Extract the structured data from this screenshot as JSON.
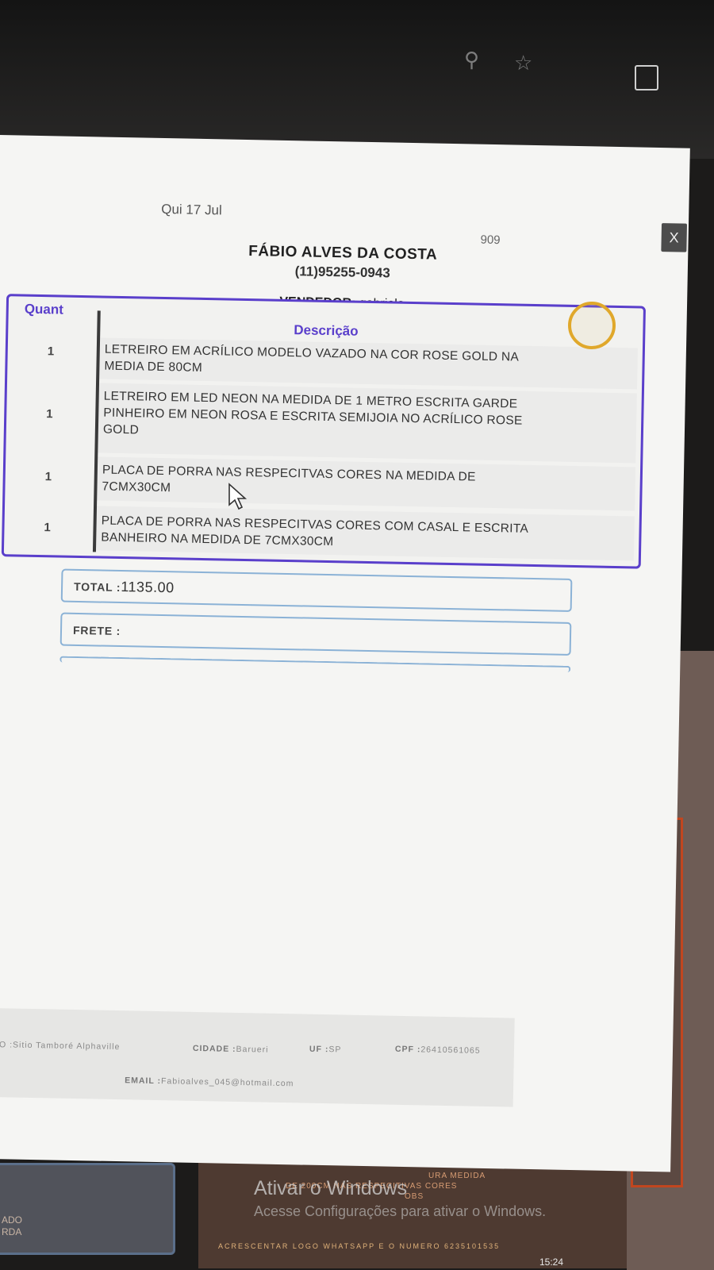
{
  "modal": {
    "close_label": "X",
    "date": "Qui 17 Jul",
    "order_number": "909",
    "customer_name": "FÁBIO ALVES DA COSTA",
    "customer_phone": "(11)95255-0943",
    "seller_label": "VENDEDOR:",
    "seller_name": "gabriela"
  },
  "items_table": {
    "headers": {
      "quant": "Quant",
      "description": "Descrição"
    },
    "rows": [
      {
        "qty": "1",
        "description": "LETREIRO EM ACRÍLICO MODELO VAZADO NA COR ROSE GOLD NA MEDIA DE 80CM"
      },
      {
        "qty": "1",
        "description": "LETREIRO EM LED NEON NA MEDIDA DE 1 METRO ESCRITA GARDE PINHEIRO EM NEON ROSA E ESCRITA SEMIJOIA NO ACRÍLICO ROSE GOLD"
      },
      {
        "qty": "1",
        "description": "PLACA DE PORRA NAS RESPECITVAS CORES NA MEDIDA DE 7CMX30CM"
      },
      {
        "qty": "1",
        "description": "PLACA DE PORRA NAS RESPECITVAS CORES COM CASAL E ESCRITA BANHEIRO NA MEDIDA DE 7CMX30CM"
      }
    ]
  },
  "totals": {
    "total_label": "TOTAL :",
    "total_value": "1135.00",
    "frete_label": "FRETE :",
    "frete_value": ""
  },
  "address": {
    "bairro": "IRRO :Sitio Tamboré Alphaville",
    "cidade_label": "CIDADE :",
    "cidade_value": "Barueri",
    "uf_label": "UF :",
    "uf_value": "SP",
    "cpf_label": "CPF :",
    "cpf_value": "26410561065",
    "email_label": "EMAIL :",
    "email_value": "Fabioalves_045@hotmail.com"
  },
  "background": {
    "watermark_title": "Ativar o Windows",
    "watermark_sub": "Acesse Configurações para ativar o Windows.",
    "bottom_text_1": "URA MEDIDA",
    "bottom_text_2": "DE 200CM NAS RESPECITIVAS CORES",
    "bottom_text_3": "OBS",
    "bottom_text_4": "ACRESCENTAR LOGO WHATSAPP E O NUMERO 6235101535",
    "left_text_1": "ADO",
    "left_text_2": "RDA",
    "taskbar_time": "15:24"
  },
  "colors": {
    "accent_purple": "#5a3fcb",
    "box_border_blue": "#8bb2d6",
    "modal_bg": "#f5f5f3",
    "cursor_ring": "#e0a82b",
    "bg_orange": "#c1461f"
  },
  "icons": [
    "zoom-icon",
    "star-icon",
    "extensions-icon",
    "close-icon",
    "mouse-pointer-icon"
  ]
}
